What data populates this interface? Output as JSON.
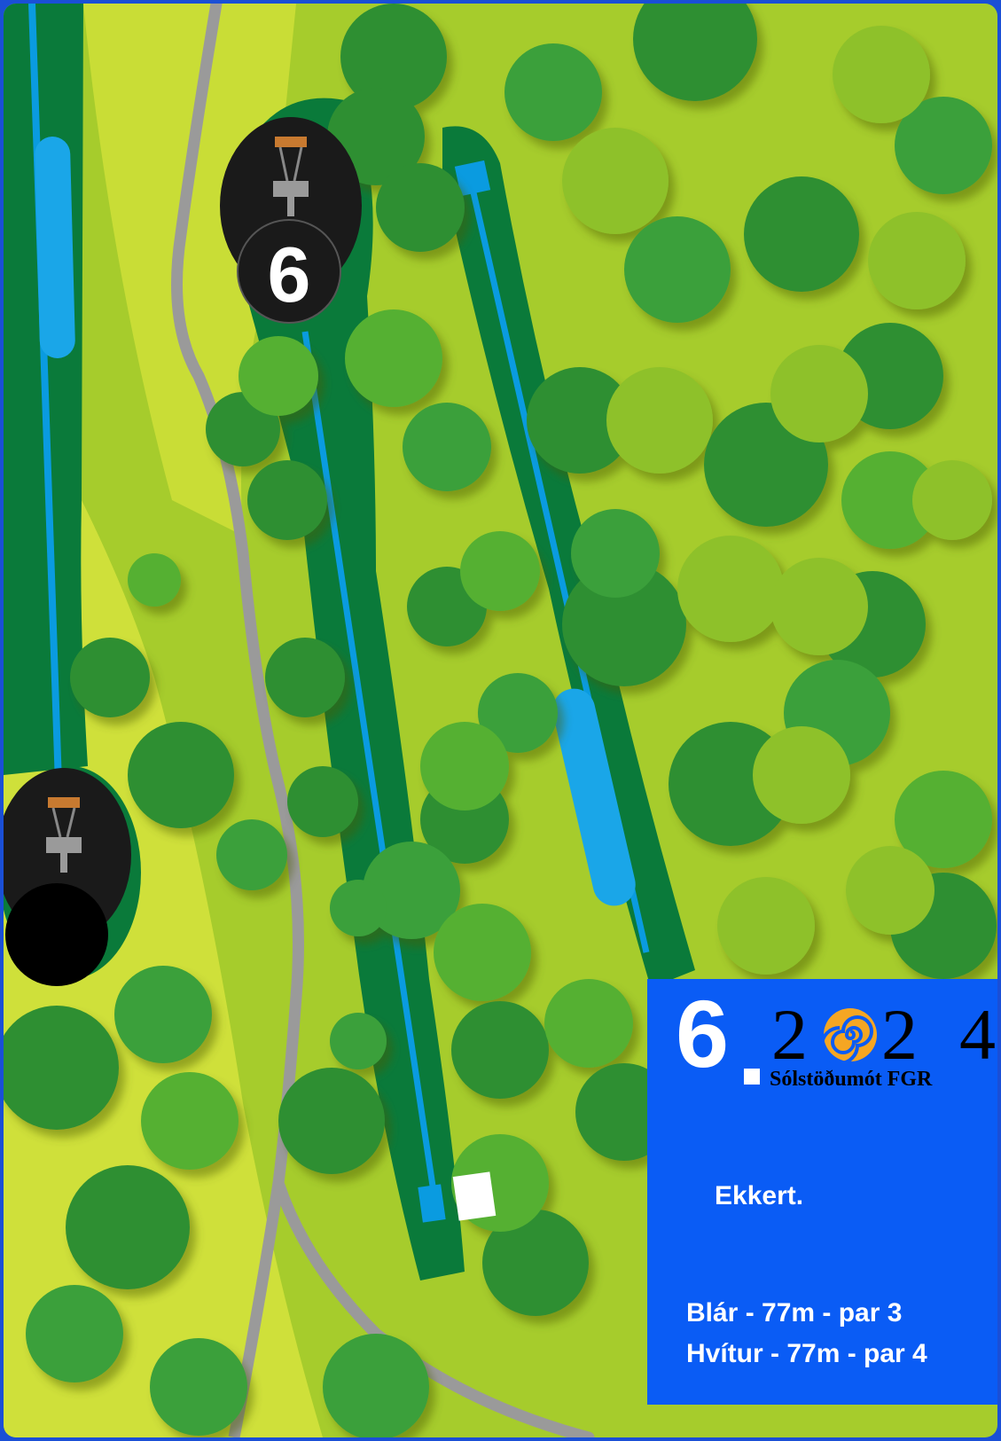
{
  "hole": {
    "number": "6",
    "map_marker": "6"
  },
  "event": {
    "year_digits": [
      "2",
      "2",
      "4"
    ],
    "logo_icon": "sun-spiral-icon",
    "name": "Sólstöðumót FGR"
  },
  "note": "Ekkert.",
  "tees": [
    {
      "text": "Blár - 77m - par 3",
      "color": "#0a8be0"
    },
    {
      "text": "Hvítur - 77m - par 4",
      "color": "#ffffff"
    }
  ],
  "colors": {
    "background": "#a6cc2c",
    "path": "#999999",
    "fairway": "#0a7a3a",
    "tee_line": "#0a9be0",
    "info_panel": "#0a5cf5",
    "basket": "#1a1a1a",
    "trees": [
      "#3ba03a",
      "#2e8f33",
      "#54b033",
      "#8ec12a"
    ]
  }
}
